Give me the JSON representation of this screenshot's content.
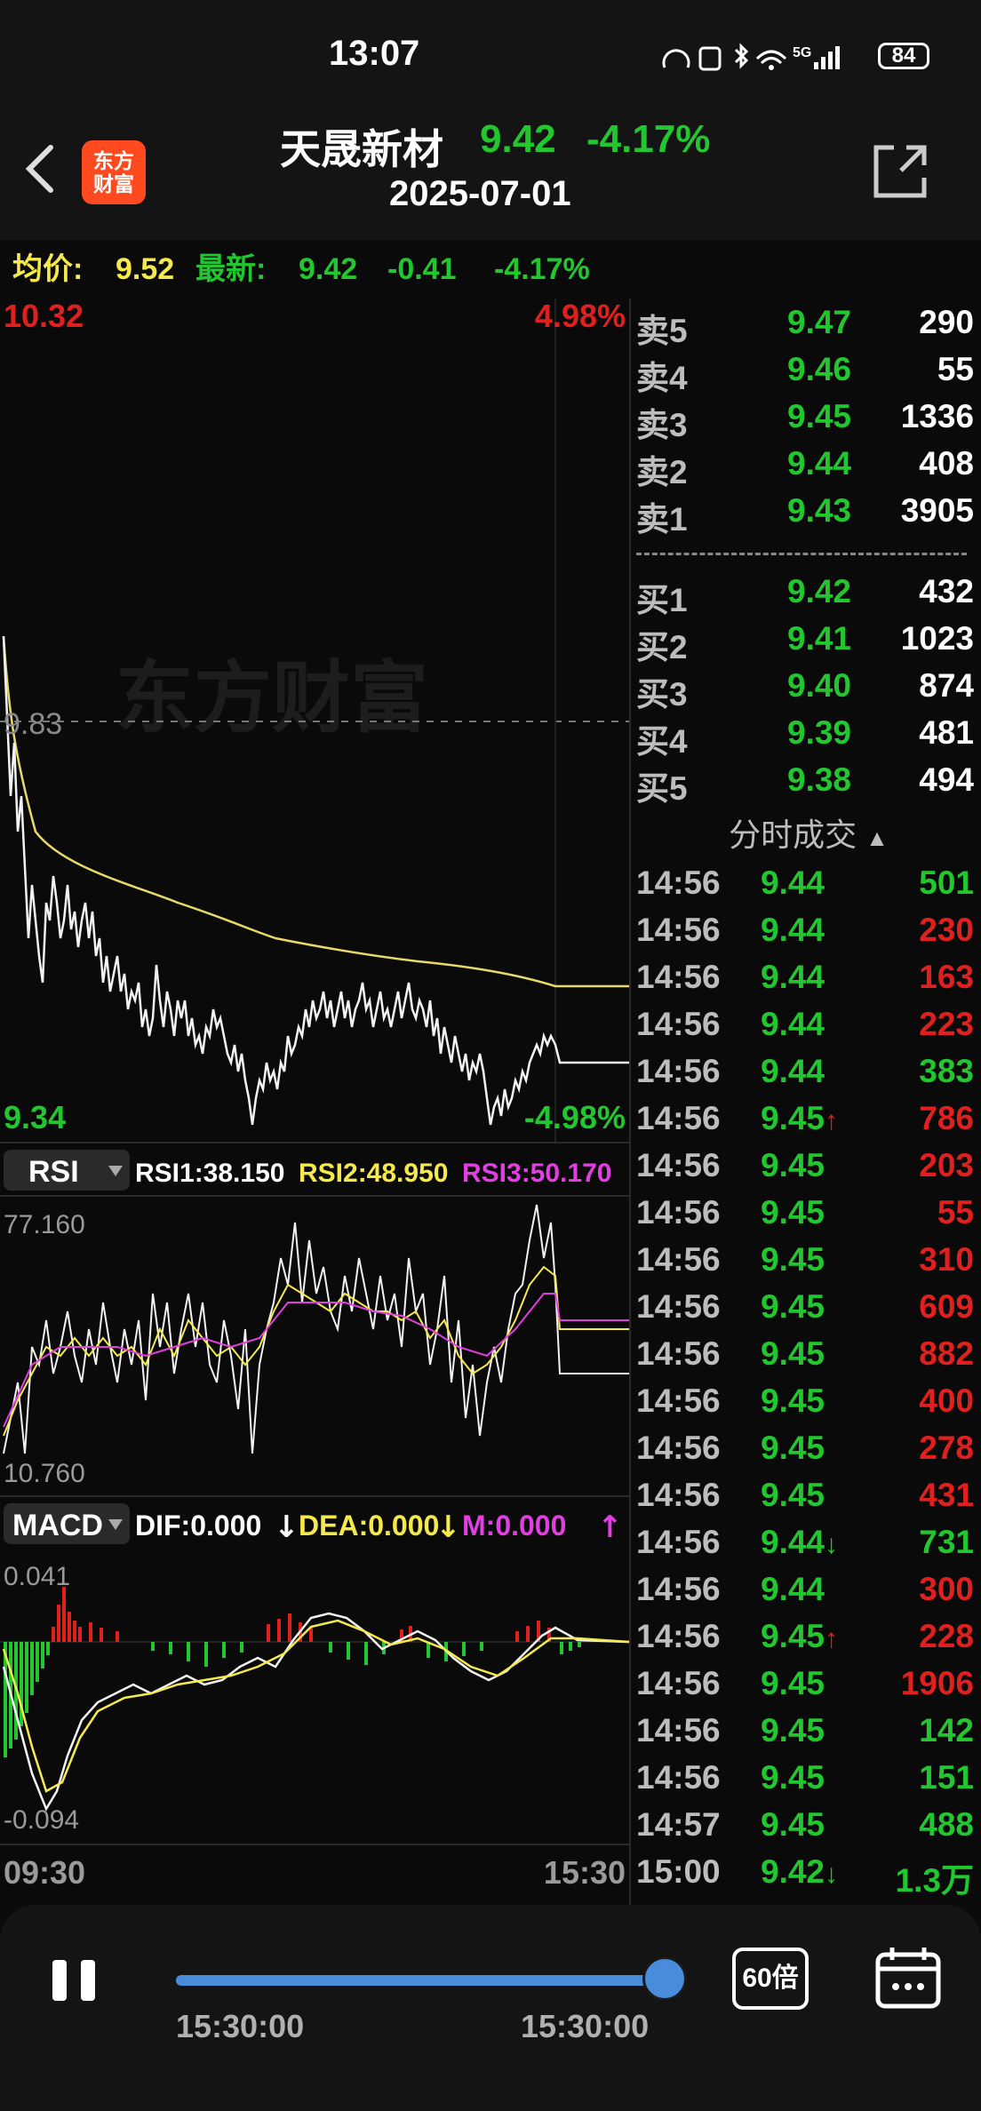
{
  "status": {
    "time": "13:07",
    "battery": "84"
  },
  "header": {
    "logo_text": [
      "东方",
      "财富"
    ],
    "name": "天晟新材",
    "price": "9.42",
    "change_pct": "-4.17%",
    "date": "2025-07-01"
  },
  "info": {
    "avg_label": "均价:",
    "avg": "9.52",
    "last_label": "最新:",
    "last": "9.42",
    "change": "-0.41",
    "change_pct": "-4.17%"
  },
  "main_chart": {
    "top_price": "10.32",
    "top_pct": "4.98%",
    "mid_price": "9.83",
    "bottom_price": "9.34",
    "bottom_pct": "-4.98%",
    "watermark": "东方财富"
  },
  "rsi": {
    "tag": "RSI",
    "rsi1": "RSI1:38.150",
    "rsi2": "RSI2:48.950",
    "rsi3": "RSI3:50.170",
    "max": "77.160",
    "min": "10.760"
  },
  "macd": {
    "tag": "MACD",
    "dif": "DIF:0.000",
    "dea": "DEA:0.000",
    "m": "M:0.000",
    "max": "0.041",
    "min": "-0.094",
    "time_start": "09:30",
    "time_end": "15:30"
  },
  "orderbook": {
    "sell": [
      {
        "label": "卖5",
        "price": "9.47",
        "vol": "290"
      },
      {
        "label": "卖4",
        "price": "9.46",
        "vol": "55"
      },
      {
        "label": "卖3",
        "price": "9.45",
        "vol": "1336"
      },
      {
        "label": "卖2",
        "price": "9.44",
        "vol": "408"
      },
      {
        "label": "卖1",
        "price": "9.43",
        "vol": "3905"
      }
    ],
    "buy": [
      {
        "label": "买1",
        "price": "9.42",
        "vol": "432"
      },
      {
        "label": "买2",
        "price": "9.41",
        "vol": "1023"
      },
      {
        "label": "买3",
        "price": "9.40",
        "vol": "874"
      },
      {
        "label": "买4",
        "price": "9.39",
        "vol": "481"
      },
      {
        "label": "买5",
        "price": "9.38",
        "vol": "494"
      }
    ]
  },
  "trades": {
    "title": "分时成交",
    "rows": [
      {
        "time": "14:56",
        "price": "9.44",
        "arrow": "",
        "vol": "501",
        "color": "#22c62f"
      },
      {
        "time": "14:56",
        "price": "9.44",
        "arrow": "",
        "vol": "230",
        "color": "#e0201f"
      },
      {
        "time": "14:56",
        "price": "9.44",
        "arrow": "",
        "vol": "163",
        "color": "#e0201f"
      },
      {
        "time": "14:56",
        "price": "9.44",
        "arrow": "",
        "vol": "223",
        "color": "#e0201f"
      },
      {
        "time": "14:56",
        "price": "9.44",
        "arrow": "",
        "vol": "383",
        "color": "#22c62f"
      },
      {
        "time": "14:56",
        "price": "9.45",
        "arrow": "↑",
        "vol": "786",
        "color": "#e0201f"
      },
      {
        "time": "14:56",
        "price": "9.45",
        "arrow": "",
        "vol": "203",
        "color": "#e0201f"
      },
      {
        "time": "14:56",
        "price": "9.45",
        "arrow": "",
        "vol": "55",
        "color": "#e0201f"
      },
      {
        "time": "14:56",
        "price": "9.45",
        "arrow": "",
        "vol": "310",
        "color": "#e0201f"
      },
      {
        "time": "14:56",
        "price": "9.45",
        "arrow": "",
        "vol": "609",
        "color": "#e0201f"
      },
      {
        "time": "14:56",
        "price": "9.45",
        "arrow": "",
        "vol": "882",
        "color": "#e0201f"
      },
      {
        "time": "14:56",
        "price": "9.45",
        "arrow": "",
        "vol": "400",
        "color": "#e0201f"
      },
      {
        "time": "14:56",
        "price": "9.45",
        "arrow": "",
        "vol": "278",
        "color": "#e0201f"
      },
      {
        "time": "14:56",
        "price": "9.45",
        "arrow": "",
        "vol": "431",
        "color": "#e0201f"
      },
      {
        "time": "14:56",
        "price": "9.44",
        "arrow": "↓",
        "vol": "731",
        "color": "#22c62f"
      },
      {
        "time": "14:56",
        "price": "9.44",
        "arrow": "",
        "vol": "300",
        "color": "#e0201f"
      },
      {
        "time": "14:56",
        "price": "9.45",
        "arrow": "↑",
        "vol": "228",
        "color": "#e0201f"
      },
      {
        "time": "14:56",
        "price": "9.45",
        "arrow": "",
        "vol": "1906",
        "color": "#e0201f"
      },
      {
        "time": "14:56",
        "price": "9.45",
        "arrow": "",
        "vol": "142",
        "color": "#22c62f"
      },
      {
        "time": "14:56",
        "price": "9.45",
        "arrow": "",
        "vol": "151",
        "color": "#22c62f"
      },
      {
        "time": "14:57",
        "price": "9.45",
        "arrow": "",
        "vol": "488",
        "color": "#22c62f"
      },
      {
        "time": "15:00",
        "price": "9.42",
        "arrow": "↓",
        "vol": "1.3万",
        "color": "#22c62f"
      }
    ]
  },
  "playback": {
    "start_time": "15:30:00",
    "current_time": "15:30:00",
    "speed": "60倍",
    "progress": 1.0
  }
}
